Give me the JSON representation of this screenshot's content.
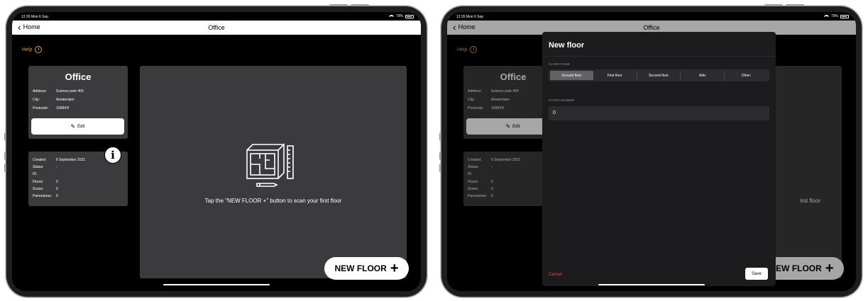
{
  "status": {
    "time": "12:26  Mon 6 Sep",
    "battery": "79%"
  },
  "nav": {
    "back_label": "Home",
    "title": "Office"
  },
  "help_label": "Help",
  "address_card": {
    "title": "Office",
    "address_label": "Address:",
    "address": "Science park 400",
    "city_label": "City:",
    "city": "Amsterdam",
    "postcode_label": "Postcode:",
    "postcode": "1098XH",
    "edit_label": "Edit"
  },
  "meta_card": {
    "created_label": "Created:",
    "created": "6 September 2021",
    "status_label": "Status:",
    "status": "-",
    "id_label": "ID:",
    "id": "",
    "floors_label": "Floors:",
    "floors": "0",
    "scans_label": "Scans:",
    "scans": "0",
    "panoramas_label": "Panoramas:",
    "panoramas": "0"
  },
  "info_badge": "i",
  "empty_message": "Tap the \"NEW FLOOR +\" button to scan your first floor",
  "empty_message_partial": "irst floor",
  "fab": {
    "label": "NEW FLOOR",
    "plus": "+"
  },
  "modal": {
    "title": "New floor",
    "floor_name_label": "FLOOR NAME",
    "floor_options": [
      "Ground floor",
      "First floor",
      "Second floor",
      "Attic",
      "Other:"
    ],
    "selected_option": "Ground floor",
    "floor_number_label": "FLOOR NUMBER",
    "floor_number_value": "0",
    "cancel_label": "Cancel",
    "save_label": "Save"
  },
  "colors": {
    "accent": "#e89a2a",
    "card": "#3b3b3d",
    "cancel": "#ff453a"
  },
  "icons": [
    "chevron-left-icon",
    "info-circle-icon",
    "pencil-icon",
    "blueprint-icon",
    "plus-icon",
    "wifi-icon",
    "battery-icon"
  ]
}
